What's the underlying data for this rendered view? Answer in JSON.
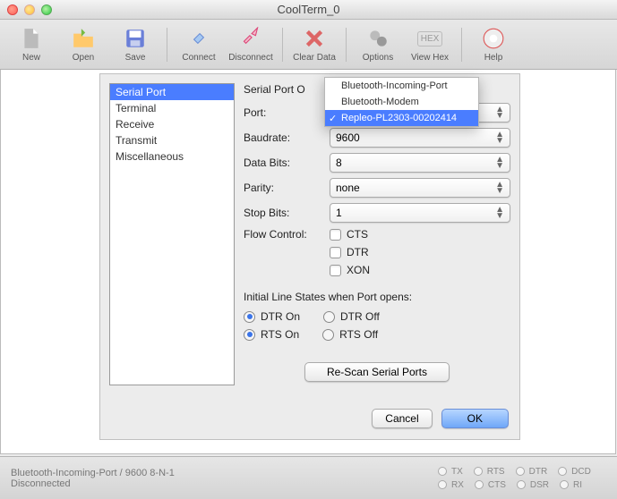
{
  "window": {
    "title": "CoolTerm_0"
  },
  "toolbar": [
    {
      "name": "new",
      "label": "New"
    },
    {
      "name": "open",
      "label": "Open"
    },
    {
      "name": "save",
      "label": "Save"
    },
    {
      "name": "connect",
      "label": "Connect"
    },
    {
      "name": "disconnect",
      "label": "Disconnect"
    },
    {
      "name": "cleardata",
      "label": "Clear Data"
    },
    {
      "name": "options",
      "label": "Options"
    },
    {
      "name": "viewhex",
      "label": "View Hex"
    },
    {
      "name": "help",
      "label": "Help"
    }
  ],
  "sidebar": {
    "items": [
      {
        "label": "Serial Port",
        "selected": true
      },
      {
        "label": "Terminal"
      },
      {
        "label": "Receive"
      },
      {
        "label": "Transmit"
      },
      {
        "label": "Miscellaneous"
      }
    ]
  },
  "panel": {
    "header": "Serial Port O",
    "portLabel": "Port:",
    "baudLabel": "Baudrate:",
    "baudValue": "9600",
    "dataLabel": "Data Bits:",
    "dataValue": "8",
    "parityLabel": "Parity:",
    "parityValue": "none",
    "stopLabel": "Stop Bits:",
    "stopValue": "1",
    "flowLabel": "Flow Control:",
    "ctsLabel": "CTS",
    "dtrLabel": "DTR",
    "xonLabel": "XON",
    "initHdr": "Initial Line States when Port opens:",
    "dtrOn": "DTR On",
    "dtrOff": "DTR Off",
    "rtsOn": "RTS On",
    "rtsOff": "RTS Off",
    "rescan": "Re-Scan Serial Ports",
    "cancel": "Cancel",
    "ok": "OK"
  },
  "portDropdown": {
    "options": [
      {
        "label": "Bluetooth-Incoming-Port"
      },
      {
        "label": "Bluetooth-Modem"
      },
      {
        "label": "Repleo-PL2303-00202414",
        "selected": true
      }
    ]
  },
  "status": {
    "line1": "Bluetooth-Incoming-Port / 9600 8-N-1",
    "line2": "Disconnected",
    "inds": [
      "TX",
      "RX",
      "RTS",
      "CTS",
      "DTR",
      "DSR",
      "DCD",
      "RI"
    ]
  }
}
